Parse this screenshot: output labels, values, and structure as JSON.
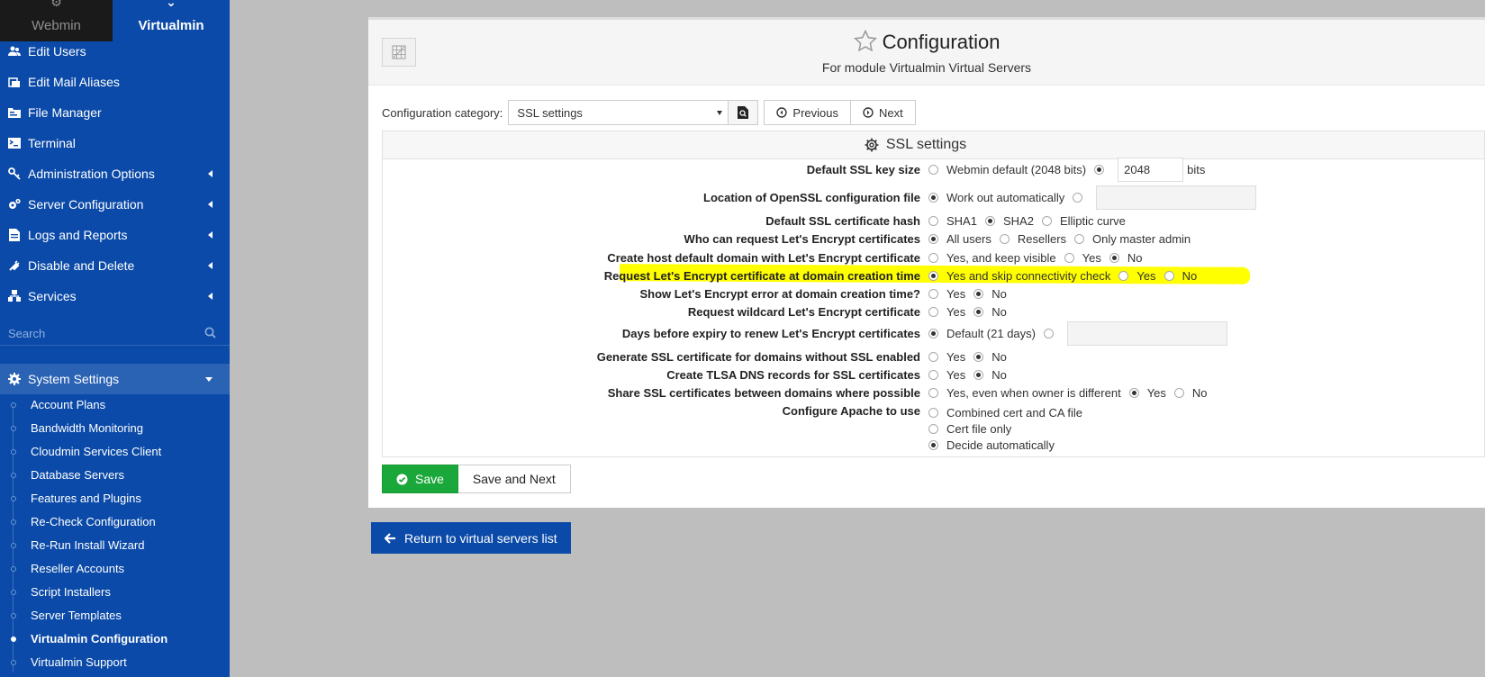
{
  "sidebar": {
    "switch": {
      "webmin": "Webmin",
      "virtualmin": "Virtualmin"
    },
    "items": [
      {
        "label": "Edit Users",
        "icon": "users-icon"
      },
      {
        "label": "Edit Mail Aliases",
        "icon": "mail-aliases-icon"
      },
      {
        "label": "File Manager",
        "icon": "folder-icon"
      },
      {
        "label": "Terminal",
        "icon": "terminal-icon"
      },
      {
        "label": "Administration Options",
        "icon": "key-icon"
      },
      {
        "label": "Server Configuration",
        "icon": "cogs-icon"
      },
      {
        "label": "Logs and Reports",
        "icon": "document-icon"
      },
      {
        "label": "Disable and Delete",
        "icon": "plug-icon"
      },
      {
        "label": "Services",
        "icon": "sitemap-icon"
      }
    ],
    "search_placeholder": "Search",
    "system_settings": "System Settings",
    "sub_items": [
      "Account Plans",
      "Bandwidth Monitoring",
      "Cloudmin Services Client",
      "Database Servers",
      "Features and Plugins",
      "Re-Check Configuration",
      "Re-Run Install Wizard",
      "Reseller Accounts",
      "Script Installers",
      "Server Templates",
      "Virtualmin Configuration",
      "Virtualmin Support"
    ],
    "current_sub": "Virtualmin Configuration"
  },
  "header": {
    "title": "Configuration",
    "subtitle": "For module Virtualmin Virtual Servers"
  },
  "category": {
    "label": "Configuration category:",
    "selected": "SSL settings",
    "previous": "Previous",
    "next": "Next"
  },
  "section": {
    "title": "SSL settings",
    "rows": [
      {
        "label": "Default SSL key size",
        "options": [
          "Webmin default (2048 bits)",
          ""
        ],
        "value": "2048",
        "suffix": "bits"
      },
      {
        "label": "Location of OpenSSL configuration file",
        "options": [
          "Work out automatically",
          ""
        ]
      },
      {
        "label": "Default SSL certificate hash",
        "options": [
          "SHA1",
          "SHA2",
          "Elliptic curve"
        ]
      },
      {
        "label": "Who can request Let's Encrypt certificates",
        "options": [
          "All users",
          "Resellers",
          "Only master admin"
        ]
      },
      {
        "label": "Create host default domain with Let's Encrypt certificate",
        "options": [
          "Yes, and keep visible",
          "Yes",
          "No"
        ]
      },
      {
        "label": "Request Let's Encrypt certificate at domain creation time",
        "options": [
          "Yes and skip connectivity check",
          "Yes",
          "No"
        ]
      },
      {
        "label": "Show Let's Encrypt error at domain creation time?",
        "options": [
          "Yes",
          "No"
        ]
      },
      {
        "label": "Request wildcard Let's Encrypt certificate",
        "options": [
          "Yes",
          "No"
        ]
      },
      {
        "label": "Days before expiry to renew Let's Encrypt certificates",
        "options": [
          "Default (21 days)",
          ""
        ]
      },
      {
        "label": "Generate SSL certificate for domains without SSL enabled",
        "options": [
          "Yes",
          "No"
        ]
      },
      {
        "label": "Create TLSA DNS records for SSL certificates",
        "options": [
          "Yes",
          "No"
        ]
      },
      {
        "label": "Share SSL certificates between domains where possible",
        "options": [
          "Yes, even when owner is different",
          "Yes",
          "No"
        ]
      },
      {
        "label": "Configure Apache to use",
        "options": [
          "Combined cert and CA file",
          "Cert file only",
          "Decide automatically"
        ]
      }
    ]
  },
  "buttons": {
    "save": "Save",
    "save_next": "Save and Next",
    "return": "Return to virtual servers list"
  },
  "colors": {
    "sidebar": "#0b4aa8",
    "save": "#1ba83a",
    "highlight": "#ffff00"
  }
}
